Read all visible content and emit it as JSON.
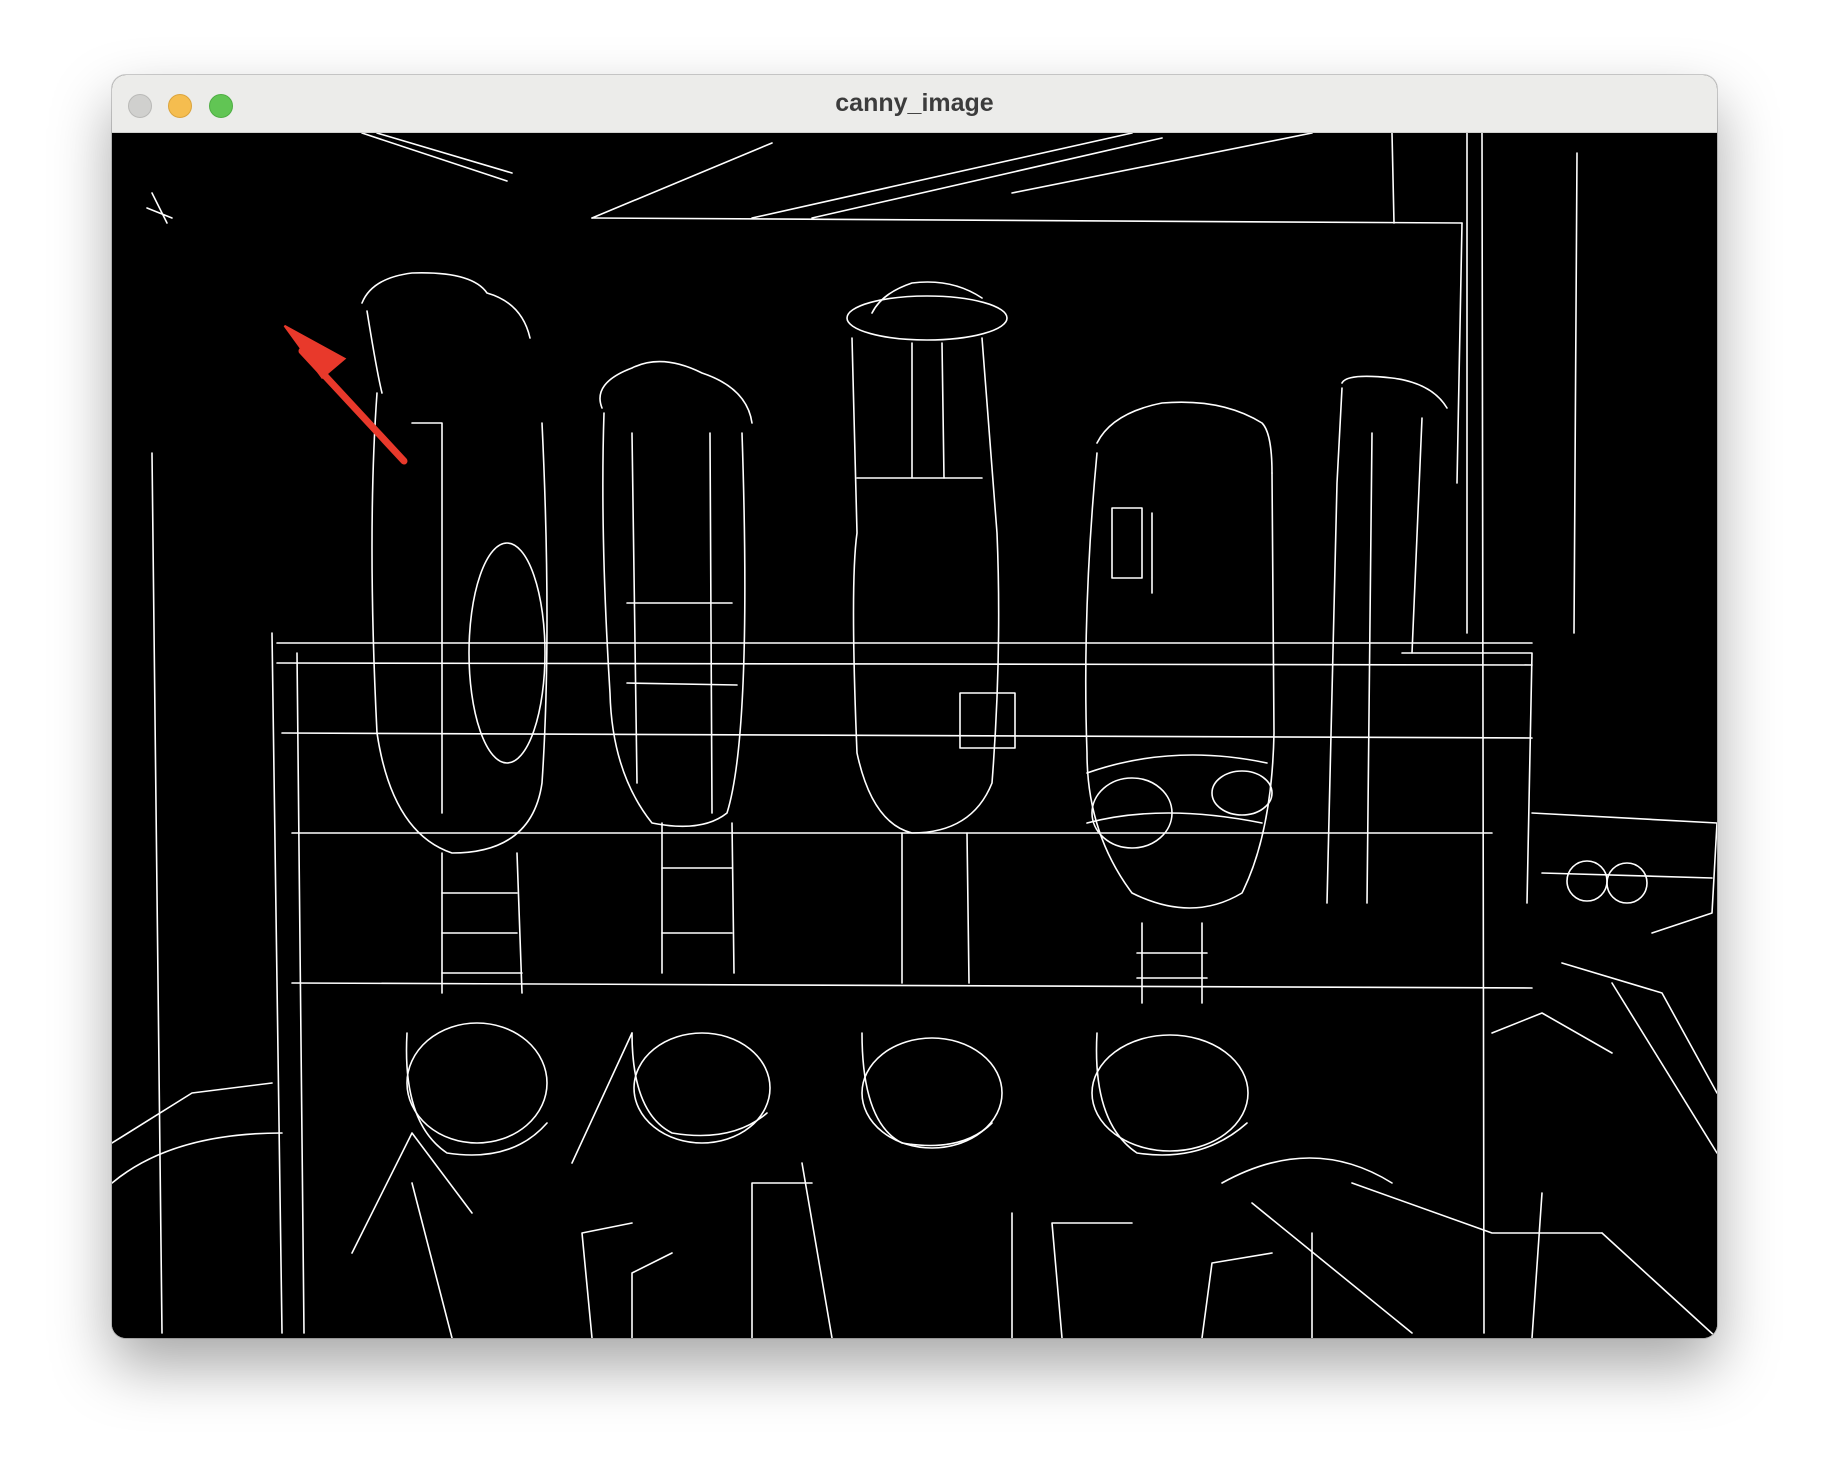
{
  "window": {
    "title": "canny_image"
  },
  "colors": {
    "canvas_background": "#000000",
    "edge_color": "#ffffff",
    "arrow_color": "#e8392b",
    "titlebar_background": "#ececea",
    "close_button": "#d0d0ce",
    "minimize_button": "#f5bd4f",
    "maximize_button": "#61c554"
  },
  "image": {
    "description_icon": "canny-edge-detection-image",
    "annotation": "red-arrow-icon"
  }
}
